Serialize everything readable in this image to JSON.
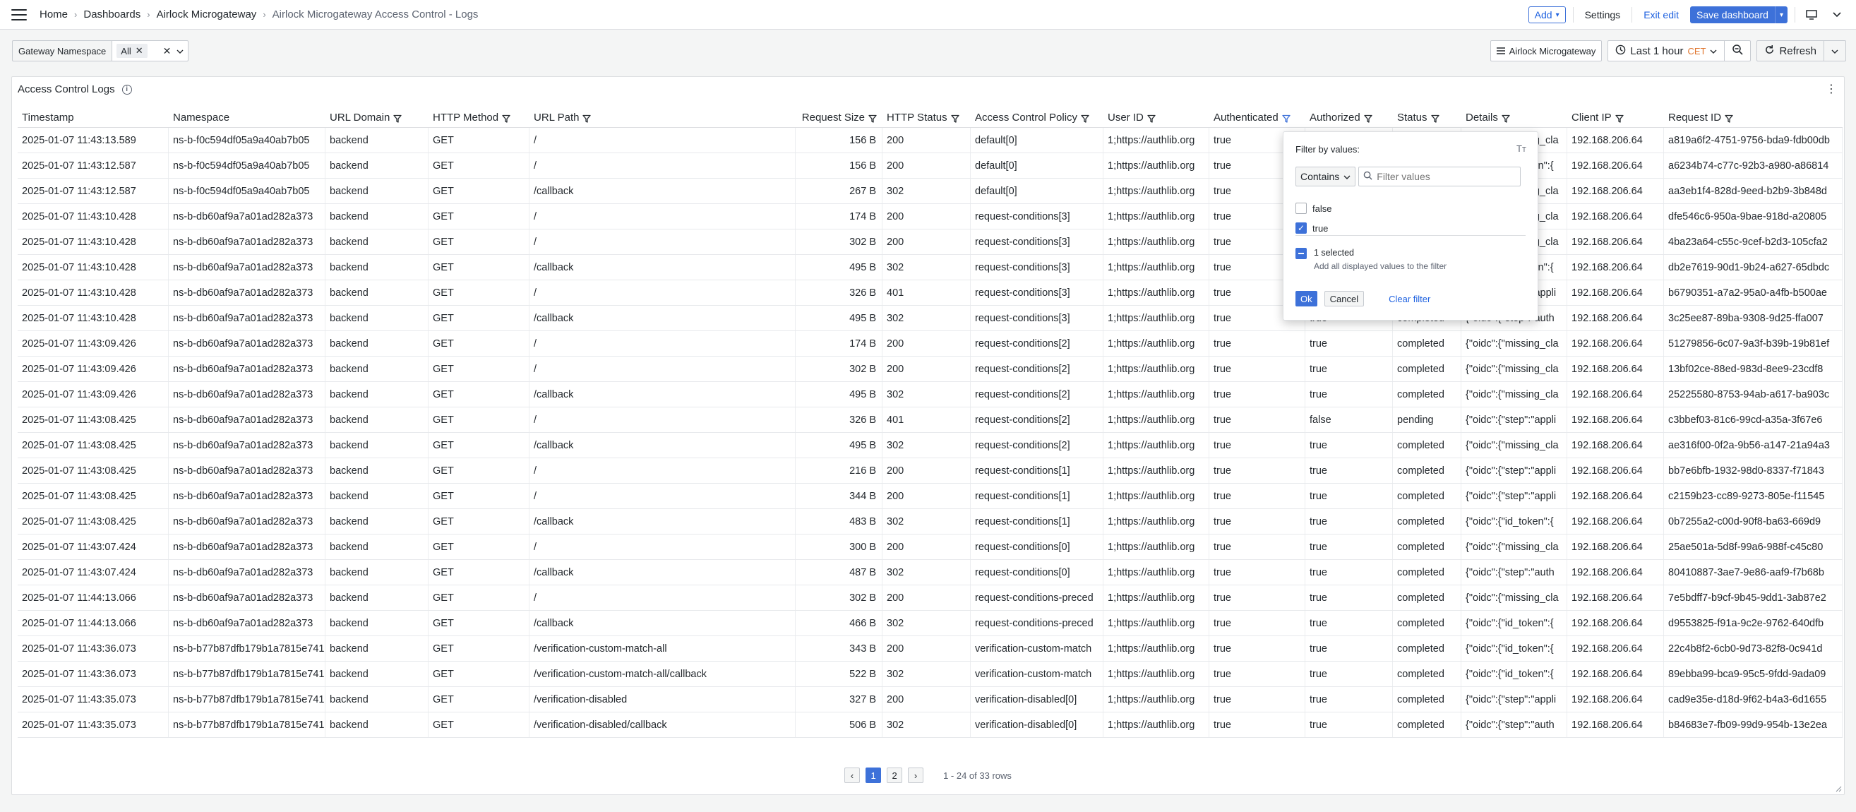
{
  "breadcrumb": [
    "Home",
    "Dashboards",
    "Airlock Microgateway",
    "Airlock Microgateway Access Control - Logs"
  ],
  "toolbar": {
    "add_label": "Add",
    "settings_label": "Settings",
    "exit_edit_label": "Exit edit",
    "save_dashboard_label": "Save dashboard"
  },
  "variables": {
    "label": "Gateway Namespace",
    "selected": "All"
  },
  "controls": {
    "dashboard_link": "Airlock Microgateway",
    "time_range": "Last 1 hour",
    "timezone": "CET",
    "refresh_label": "Refresh"
  },
  "panel": {
    "title": "Access Control Logs"
  },
  "table": {
    "columns": [
      {
        "label": "Timestamp",
        "filter": false
      },
      {
        "label": "Namespace",
        "filter": false
      },
      {
        "label": "URL Domain",
        "filter": true
      },
      {
        "label": "HTTP Method",
        "filter": true
      },
      {
        "label": "URL Path",
        "filter": true
      },
      {
        "label": "Request Size",
        "filter": true
      },
      {
        "label": "HTTP Status",
        "filter": true
      },
      {
        "label": "Access Control Policy",
        "filter": true
      },
      {
        "label": "User ID",
        "filter": true
      },
      {
        "label": "Authenticated",
        "filter": true,
        "active": true
      },
      {
        "label": "Authorized",
        "filter": true
      },
      {
        "label": "Status",
        "filter": true
      },
      {
        "label": "Details",
        "filter": true
      },
      {
        "label": "Client IP",
        "filter": true
      },
      {
        "label": "Request ID",
        "filter": true
      }
    ],
    "rows": [
      [
        "2025-01-07 11:43:13.589",
        "ns-b-f0c594df05a9a40ab7b05",
        "backend",
        "GET",
        "/",
        "156 B",
        "200",
        "default[0]",
        "1;https://authlib.org",
        "true",
        "true",
        "completed",
        "{\"oidc\":{\"missing_cla",
        "192.168.206.64",
        "a819a6f2-4751-9756-bda9-fdb00db"
      ],
      [
        "2025-01-07 11:43:12.587",
        "ns-b-f0c594df05a9a40ab7b05",
        "backend",
        "GET",
        "/",
        "156 B",
        "200",
        "default[0]",
        "1;https://authlib.org",
        "true",
        "true",
        "completed",
        "{\"oidc\":{\"id_token\":{",
        "192.168.206.64",
        "a6234b74-c77c-92b3-a980-a86814"
      ],
      [
        "2025-01-07 11:43:12.587",
        "ns-b-f0c594df05a9a40ab7b05",
        "backend",
        "GET",
        "/callback",
        "267 B",
        "302",
        "default[0]",
        "1;https://authlib.org",
        "true",
        "true",
        "completed",
        "{\"oidc\":{\"missing_cla",
        "192.168.206.64",
        "aa3eb1f4-828d-9eed-b2b9-3b848d"
      ],
      [
        "2025-01-07 11:43:10.428",
        "ns-b-db60af9a7a01ad282a373",
        "backend",
        "GET",
        "/",
        "174 B",
        "200",
        "request-conditions[3]",
        "1;https://authlib.org",
        "true",
        "true",
        "completed",
        "{\"oidc\":{\"missing_cla",
        "192.168.206.64",
        "dfe546c6-950a-9bae-918d-a20805"
      ],
      [
        "2025-01-07 11:43:10.428",
        "ns-b-db60af9a7a01ad282a373",
        "backend",
        "GET",
        "/",
        "302 B",
        "200",
        "request-conditions[3]",
        "1;https://authlib.org",
        "true",
        "true",
        "completed",
        "{\"oidc\":{\"missing_cla",
        "192.168.206.64",
        "4ba23a64-c55c-9cef-b2d3-105cfa2"
      ],
      [
        "2025-01-07 11:43:10.428",
        "ns-b-db60af9a7a01ad282a373",
        "backend",
        "GET",
        "/callback",
        "495 B",
        "302",
        "request-conditions[3]",
        "1;https://authlib.org",
        "true",
        "true",
        "completed",
        "{\"oidc\":{\"id_token\":{",
        "192.168.206.64",
        "db2e7619-90d1-9b24-a627-65dbdc"
      ],
      [
        "2025-01-07 11:43:10.428",
        "ns-b-db60af9a7a01ad282a373",
        "backend",
        "GET",
        "/",
        "326 B",
        "401",
        "request-conditions[3]",
        "1;https://authlib.org",
        "true",
        "true",
        "completed",
        "{\"oidc\":{\"step\":\"appli",
        "192.168.206.64",
        "b6790351-a7a2-95a0-a4fb-b500ae"
      ],
      [
        "2025-01-07 11:43:10.428",
        "ns-b-db60af9a7a01ad282a373",
        "backend",
        "GET",
        "/callback",
        "495 B",
        "302",
        "request-conditions[3]",
        "1;https://authlib.org",
        "true",
        "true",
        "completed",
        "{\"oidc\":{\"step\":\"auth",
        "192.168.206.64",
        "3c25ee87-89ba-9308-9d25-ffa007"
      ],
      [
        "2025-01-07 11:43:09.426",
        "ns-b-db60af9a7a01ad282a373",
        "backend",
        "GET",
        "/",
        "174 B",
        "200",
        "request-conditions[2]",
        "1;https://authlib.org",
        "true",
        "true",
        "completed",
        "{\"oidc\":{\"missing_cla",
        "192.168.206.64",
        "51279856-6c07-9a3f-b39b-19b81ef"
      ],
      [
        "2025-01-07 11:43:09.426",
        "ns-b-db60af9a7a01ad282a373",
        "backend",
        "GET",
        "/",
        "302 B",
        "200",
        "request-conditions[2]",
        "1;https://authlib.org",
        "true",
        "true",
        "completed",
        "{\"oidc\":{\"missing_cla",
        "192.168.206.64",
        "13bf02ce-88ed-983d-8ee9-23cdf8"
      ],
      [
        "2025-01-07 11:43:09.426",
        "ns-b-db60af9a7a01ad282a373",
        "backend",
        "GET",
        "/callback",
        "495 B",
        "302",
        "request-conditions[2]",
        "1;https://authlib.org",
        "true",
        "true",
        "completed",
        "{\"oidc\":{\"missing_cla",
        "192.168.206.64",
        "25225580-8753-94ab-a617-ba903c"
      ],
      [
        "2025-01-07 11:43:08.425",
        "ns-b-db60af9a7a01ad282a373",
        "backend",
        "GET",
        "/",
        "326 B",
        "401",
        "request-conditions[2]",
        "1;https://authlib.org",
        "true",
        "false",
        "pending",
        "{\"oidc\":{\"step\":\"appli",
        "192.168.206.64",
        "c3bbef03-81c6-99cd-a35a-3f67e6"
      ],
      [
        "2025-01-07 11:43:08.425",
        "ns-b-db60af9a7a01ad282a373",
        "backend",
        "GET",
        "/callback",
        "495 B",
        "302",
        "request-conditions[2]",
        "1;https://authlib.org",
        "true",
        "true",
        "completed",
        "{\"oidc\":{\"missing_cla",
        "192.168.206.64",
        "ae316f00-0f2a-9b56-a147-21a94a3"
      ],
      [
        "2025-01-07 11:43:08.425",
        "ns-b-db60af9a7a01ad282a373",
        "backend",
        "GET",
        "/",
        "216 B",
        "200",
        "request-conditions[1]",
        "1;https://authlib.org",
        "true",
        "true",
        "completed",
        "{\"oidc\":{\"step\":\"appli",
        "192.168.206.64",
        "bb7e6bfb-1932-98d0-8337-f71843"
      ],
      [
        "2025-01-07 11:43:08.425",
        "ns-b-db60af9a7a01ad282a373",
        "backend",
        "GET",
        "/",
        "344 B",
        "200",
        "request-conditions[1]",
        "1;https://authlib.org",
        "true",
        "true",
        "completed",
        "{\"oidc\":{\"step\":\"appli",
        "192.168.206.64",
        "c2159b23-cc89-9273-805e-f11545"
      ],
      [
        "2025-01-07 11:43:08.425",
        "ns-b-db60af9a7a01ad282a373",
        "backend",
        "GET",
        "/callback",
        "483 B",
        "302",
        "request-conditions[1]",
        "1;https://authlib.org",
        "true",
        "true",
        "completed",
        "{\"oidc\":{\"id_token\":{",
        "192.168.206.64",
        "0b7255a2-c00d-90f8-ba63-669d9"
      ],
      [
        "2025-01-07 11:43:07.424",
        "ns-b-db60af9a7a01ad282a373",
        "backend",
        "GET",
        "/",
        "300 B",
        "200",
        "request-conditions[0]",
        "1;https://authlib.org",
        "true",
        "true",
        "completed",
        "{\"oidc\":{\"missing_cla",
        "192.168.206.64",
        "25ae501a-5d8f-99a6-988f-c45c80"
      ],
      [
        "2025-01-07 11:43:07.424",
        "ns-b-db60af9a7a01ad282a373",
        "backend",
        "GET",
        "/callback",
        "487 B",
        "302",
        "request-conditions[0]",
        "1;https://authlib.org",
        "true",
        "true",
        "completed",
        "{\"oidc\":{\"step\":\"auth",
        "192.168.206.64",
        "80410887-3ae7-9e86-aaf9-f7b68b"
      ],
      [
        "2025-01-07 11:44:13.066",
        "ns-b-db60af9a7a01ad282a373",
        "backend",
        "GET",
        "/",
        "302 B",
        "200",
        "request-conditions-preced",
        "1;https://authlib.org",
        "true",
        "true",
        "completed",
        "{\"oidc\":{\"missing_cla",
        "192.168.206.64",
        "7e5bdff7-b9cf-9b45-9dd1-3ab87e2"
      ],
      [
        "2025-01-07 11:44:13.066",
        "ns-b-db60af9a7a01ad282a373",
        "backend",
        "GET",
        "/callback",
        "466 B",
        "302",
        "request-conditions-preced",
        "1;https://authlib.org",
        "true",
        "true",
        "completed",
        "{\"oidc\":{\"id_token\":{",
        "192.168.206.64",
        "d9553825-f91a-9c2e-9762-640dfb"
      ],
      [
        "2025-01-07 11:43:36.073",
        "ns-b-b77b87dfb179b1a7815e741",
        "backend",
        "GET",
        "/verification-custom-match-all",
        "343 B",
        "200",
        "verification-custom-match",
        "1;https://authlib.org",
        "true",
        "true",
        "completed",
        "{\"oidc\":{\"id_token\":{",
        "192.168.206.64",
        "22c4b8f2-6cb0-9d73-82f8-0c941d"
      ],
      [
        "2025-01-07 11:43:36.073",
        "ns-b-b77b87dfb179b1a7815e741",
        "backend",
        "GET",
        "/verification-custom-match-all/callback",
        "522 B",
        "302",
        "verification-custom-match",
        "1;https://authlib.org",
        "true",
        "true",
        "completed",
        "{\"oidc\":{\"id_token\":{",
        "192.168.206.64",
        "89ebba99-bca9-95c5-9fdd-9ada09"
      ],
      [
        "2025-01-07 11:43:35.073",
        "ns-b-b77b87dfb179b1a7815e741",
        "backend",
        "GET",
        "/verification-disabled",
        "327 B",
        "200",
        "verification-disabled[0]",
        "1;https://authlib.org",
        "true",
        "true",
        "completed",
        "{\"oidc\":{\"step\":\"appli",
        "192.168.206.64",
        "cad9e35e-d18d-9f62-b4a3-6d1655"
      ],
      [
        "2025-01-07 11:43:35.073",
        "ns-b-b77b87dfb179b1a7815e741",
        "backend",
        "GET",
        "/verification-disabled/callback",
        "506 B",
        "302",
        "verification-disabled[0]",
        "1;https://authlib.org",
        "true",
        "true",
        "completed",
        "{\"oidc\":{\"step\":\"auth",
        "192.168.206.64",
        "b84683e7-fb09-99d9-954b-13e2ea"
      ]
    ]
  },
  "pagination": {
    "pages": [
      "1",
      "2"
    ],
    "current": "1",
    "info": "1 - 24 of 33 rows"
  },
  "filter_popup": {
    "title": "Filter by values:",
    "operator": "Contains",
    "search_placeholder": "Filter values",
    "options": [
      {
        "label": "false",
        "checked": false
      },
      {
        "label": "true",
        "checked": true
      }
    ],
    "selected_count": "1 selected",
    "hint": "Add all displayed values to the filter",
    "ok_label": "Ok",
    "cancel_label": "Cancel",
    "clear_label": "Clear filter"
  },
  "colors": {
    "accent": "#3d71d9",
    "timezone": "#e0752d"
  }
}
